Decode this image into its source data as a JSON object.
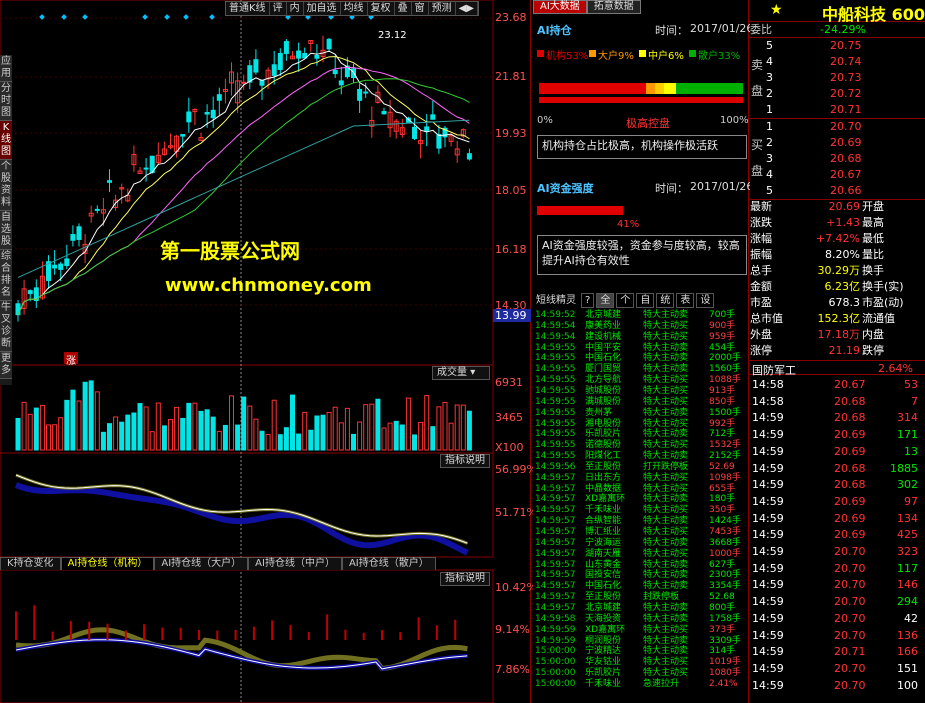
{
  "chart_toolbar": {
    "items": [
      "普通K线",
      "评",
      "内",
      "加自选",
      "均线",
      "复权",
      "叠",
      "窗",
      "预测",
      "◀▶"
    ]
  },
  "price_axis": [
    "23.68",
    "21.81",
    "19.93",
    "18.05",
    "16.18",
    "14.30"
  ],
  "price_marker": "13.99",
  "high_label": "23.12",
  "volume_label": "成交量",
  "volume_axis": [
    "6931",
    "3465",
    "X100"
  ],
  "indicator_btn": "指标说明",
  "ind1_axis": [
    "56.99%",
    "51.71%"
  ],
  "ind2_axis": [
    "10.42%",
    "9.14%",
    "7.86%"
  ],
  "left_tabs": [
    "应用",
    "分时图",
    "K线图",
    "个股资料",
    "自选股",
    "综合排名",
    "牛叉诊断",
    "更多"
  ],
  "rise_tag": "涨",
  "sub_tabs": [
    "K持仓变化",
    "AI持仓线（机构）",
    "AI持仓线（大户）",
    "AI持仓线（中户）",
    "AI持仓线（散户）"
  ],
  "watermark": {
    "line1": "第一股票公式网",
    "line2": "www.chnmoney.com"
  },
  "mid": {
    "tabs": [
      "AI大数据",
      "拓意数据"
    ],
    "hold_title": "AI持仓",
    "time_label": "时间：",
    "date": "2017/01/26",
    "legend": [
      {
        "label": "机构53%",
        "color": "#e00000"
      },
      {
        "label": "大户9%",
        "color": "#ff9900"
      },
      {
        "label": "中户6%",
        "color": "#ffff00"
      },
      {
        "label": "散户33%",
        "color": "#00b000"
      }
    ],
    "bar_shares": [
      0.53,
      0.045,
      0.045,
      0.06,
      0.33
    ],
    "scale_left": "0%",
    "scale_mid": "极高控盘",
    "scale_right": "100%",
    "hold_note": "机构持仓占比极高，机构操作极活跃",
    "fund_title": "AI资金强度",
    "fund_pct_label": "41%",
    "fund_pct": 0.41,
    "fund_note": "AI资金强度较强，资金参与度较高，较高提升AI持仓有效性",
    "ticker_tabs": [
      "短线精灵",
      "?",
      "全",
      "个",
      "自",
      "统",
      "表",
      "设"
    ],
    "ticker": [
      [
        "14:59:52",
        "北京城建",
        "特大主动卖",
        "700手"
      ],
      [
        "14:59:54",
        "康美药业",
        "特大主动买",
        "900手"
      ],
      [
        "14:59:54",
        "建设机械",
        "特大主动买",
        "959手"
      ],
      [
        "14:59:55",
        "中国平安",
        "特大主动卖",
        "454手"
      ],
      [
        "14:59:55",
        "中国石化",
        "特大主动卖",
        "2000手"
      ],
      [
        "14:59:55",
        "厦门国贸",
        "特大主动卖",
        "1560手"
      ],
      [
        "14:59:55",
        "北方导航",
        "特大主动买",
        "1088手"
      ],
      [
        "14:59:55",
        "驰城股份",
        "特大主动买",
        "913手"
      ],
      [
        "14:59:55",
        "满城股份",
        "特大主动买",
        "850手"
      ],
      [
        "14:59:55",
        "贵州茅",
        "特大主动卖",
        "1500手"
      ],
      [
        "14:59:55",
        "湘电股份",
        "特大主动买",
        "992手"
      ],
      [
        "14:59:55",
        "乐凯胶片",
        "特大主动卖",
        "712手"
      ],
      [
        "14:59:55",
        "诺德股份",
        "特大主动买",
        "1532手"
      ],
      [
        "14:59:55",
        "阳煤化工",
        "特大主动卖",
        "2152手"
      ],
      [
        "14:59:56",
        "至正股份",
        "打开跌停板",
        "52.69"
      ],
      [
        "14:59:57",
        "日出东方",
        "特大主动买",
        "1098手"
      ],
      [
        "14:59:57",
        "中晶数据",
        "特大主动买",
        "655手"
      ],
      [
        "14:59:57",
        "XD嘉寓环",
        "特大主动卖",
        "180手"
      ],
      [
        "14:59:57",
        "千禾味业",
        "特大主动买",
        "350手"
      ],
      [
        "14:59:57",
        "合纵智能",
        "特大主动卖",
        "1424手"
      ],
      [
        "14:59:57",
        "博汇纸业",
        "特大主动买",
        "7453手"
      ],
      [
        "14:59:57",
        "宁波海运",
        "特大主动卖",
        "3668手"
      ],
      [
        "14:59:57",
        "湖南天雁",
        "特大主动买",
        "1000手"
      ],
      [
        "14:59:57",
        "山东黄金",
        "特大主动卖",
        "627手"
      ],
      [
        "14:59:57",
        "国投安信",
        "特大主动卖",
        "2300手"
      ],
      [
        "14:59:57",
        "中国石化",
        "特大主动卖",
        "3354手"
      ],
      [
        "14:59:57",
        "至正股份",
        "封跌停板",
        "52.68"
      ],
      [
        "14:59:57",
        "北京城建",
        "特大主动卖",
        "800手"
      ],
      [
        "14:59:58",
        "天海投资",
        "特大主动卖",
        "1758手"
      ],
      [
        "14:59:59",
        "XD嘉寓环",
        "特大主动买",
        "373手"
      ],
      [
        "14:59:59",
        "桐润股份",
        "特大主动卖",
        "3309手"
      ],
      [
        "15:00:00",
        "宁波精达",
        "特大主动卖",
        "314手"
      ],
      [
        "15:00:00",
        "华友钴业",
        "特大主动买",
        "1019手"
      ],
      [
        "15:00:00",
        "乐凯胶片",
        "特大主动买",
        "1080手"
      ],
      [
        "15:00:00",
        "千禾味业",
        "急速拉升",
        "2.41%"
      ]
    ]
  },
  "quote": {
    "name": "中船科技 600",
    "weibi_label": "委比",
    "weibi": "-24.29%",
    "sell_label": "卖盘",
    "buy_label": "买盘",
    "sells": [
      [
        "5",
        "20.75"
      ],
      [
        "4",
        "20.74"
      ],
      [
        "3",
        "20.73"
      ],
      [
        "2",
        "20.72"
      ],
      [
        "1",
        "20.71"
      ]
    ],
    "buys": [
      [
        "1",
        "20.70"
      ],
      [
        "2",
        "20.69"
      ],
      [
        "3",
        "20.68"
      ],
      [
        "4",
        "20.67"
      ],
      [
        "5",
        "20.66"
      ]
    ],
    "stats": [
      {
        "l": "最新",
        "v": "20.69",
        "vc": "red",
        "r": "开盘",
        "rv": ""
      },
      {
        "l": "涨跌",
        "v": "+1.43",
        "vc": "red",
        "r": "最高",
        "rv": ""
      },
      {
        "l": "涨幅",
        "v": "+7.42%",
        "vc": "red",
        "r": "最低",
        "rv": ""
      },
      {
        "l": "振幅",
        "v": "8.20%",
        "vc": "white",
        "r": "量比",
        "rv": ""
      },
      {
        "l": "总手",
        "v": "30.29万",
        "vc": "yellow",
        "r": "换手",
        "rv": ""
      },
      {
        "l": "金额",
        "v": "6.23亿",
        "vc": "yellow",
        "r": "换手(实)",
        "rv": ""
      },
      {
        "l": "市盈",
        "v": "678.3",
        "vc": "white",
        "r": "市盈(动)",
        "rv": ""
      },
      {
        "l": "总市值",
        "v": "152.3亿",
        "vc": "yellow",
        "r": "流通值",
        "rv": ""
      },
      {
        "l": "外盘",
        "v": "17.18万",
        "vc": "red",
        "r": "内盘",
        "rv": ""
      },
      {
        "l": "涨停",
        "v": "21.19",
        "vc": "red",
        "r": "跌停",
        "rv": ""
      }
    ],
    "sector": "国防军工",
    "sector_pct": "2.64%",
    "trades": [
      [
        "14:58",
        "20.67",
        "53",
        "red"
      ],
      [
        "14:58",
        "20.68",
        "7",
        "red"
      ],
      [
        "14:59",
        "20.68",
        "314",
        "red"
      ],
      [
        "14:59",
        "20.69",
        "171",
        "green"
      ],
      [
        "14:59",
        "20.69",
        "13",
        "green"
      ],
      [
        "14:59",
        "20.68",
        "1885",
        "green"
      ],
      [
        "14:59",
        "20.68",
        "302",
        "green"
      ],
      [
        "14:59",
        "20.69",
        "97",
        "red"
      ],
      [
        "14:59",
        "20.69",
        "134",
        "red"
      ],
      [
        "14:59",
        "20.69",
        "425",
        "red"
      ],
      [
        "14:59",
        "20.70",
        "323",
        "red"
      ],
      [
        "14:59",
        "20.70",
        "117",
        "green"
      ],
      [
        "14:59",
        "20.70",
        "146",
        "red"
      ],
      [
        "14:59",
        "20.70",
        "294",
        "green"
      ],
      [
        "14:59",
        "20.70",
        "42",
        "white"
      ],
      [
        "14:59",
        "20.70",
        "136",
        "red"
      ],
      [
        "14:59",
        "20.71",
        "166",
        "red"
      ],
      [
        "14:59",
        "20.70",
        "151",
        "white"
      ],
      [
        "14:59",
        "20.70",
        "100",
        "white"
      ]
    ]
  }
}
